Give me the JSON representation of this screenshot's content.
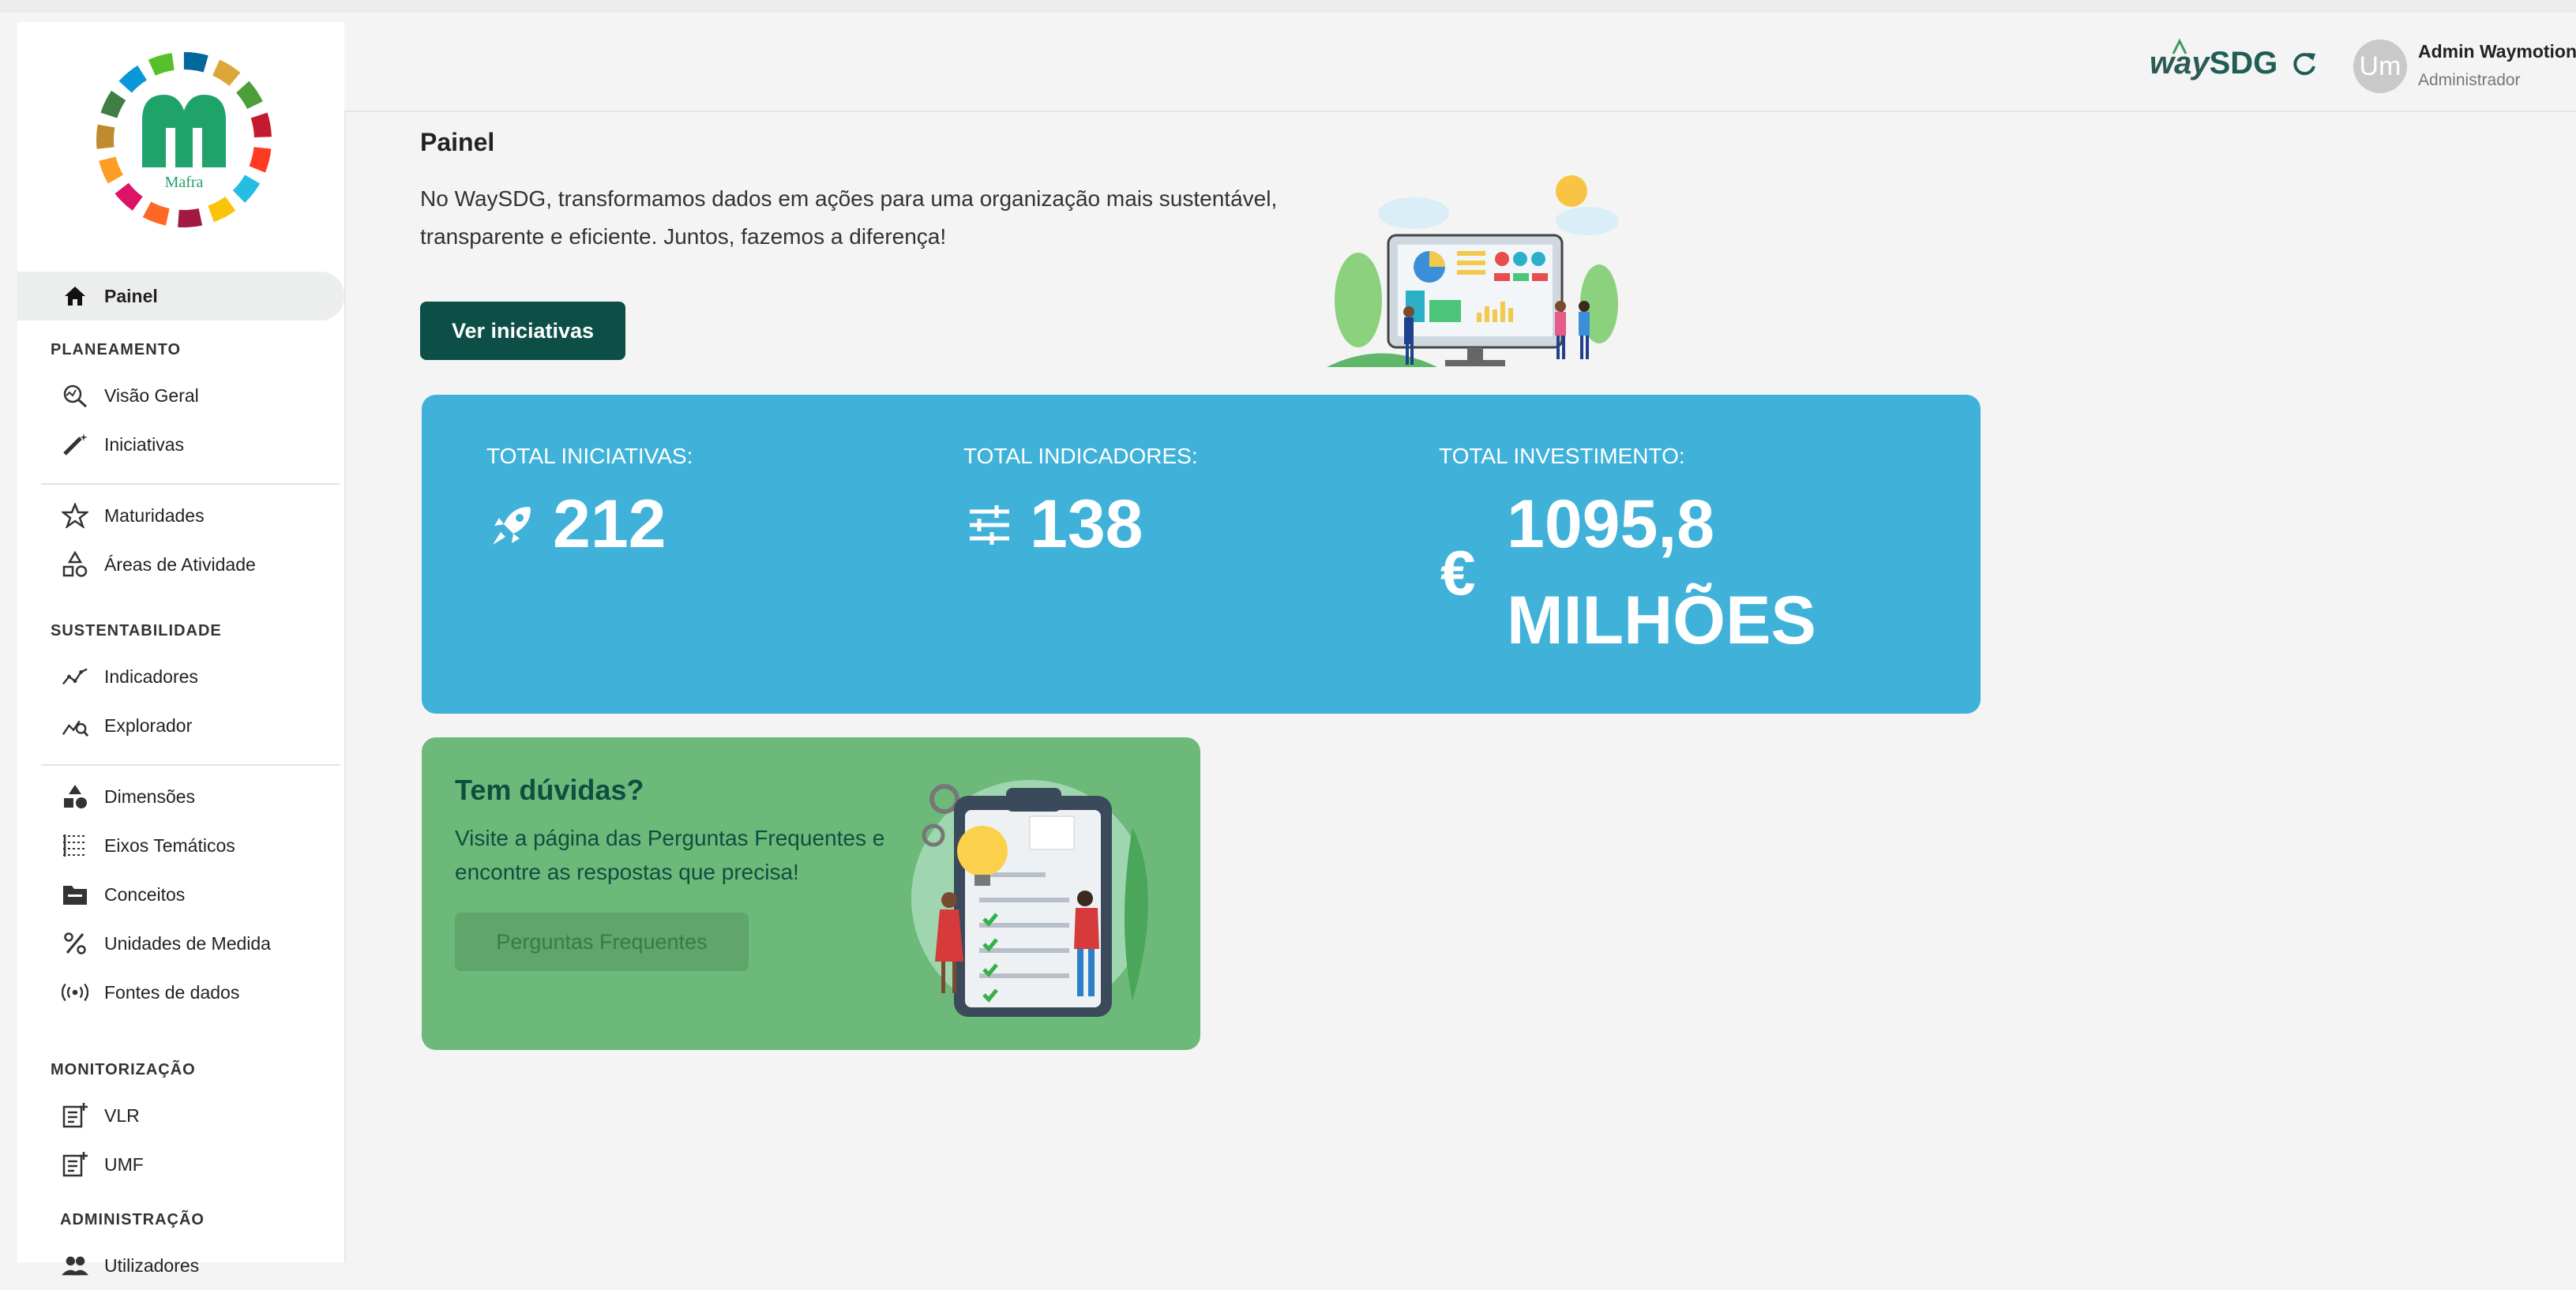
{
  "sidebar": {
    "logo_text": "Mafra",
    "items": [
      {
        "label": "Painel",
        "icon": "home-icon"
      },
      {
        "label": "Visão Geral",
        "icon": "analytics-icon"
      },
      {
        "label": "Iniciativas",
        "icon": "wand-icon"
      },
      {
        "label": "Maturidades",
        "icon": "star-icon"
      },
      {
        "label": "Áreas de Atividade",
        "icon": "shapes-icon"
      },
      {
        "label": "Indicadores",
        "icon": "trend-icon"
      },
      {
        "label": "Explorador",
        "icon": "explore-chart-icon"
      },
      {
        "label": "Dimensões",
        "icon": "category-icon"
      },
      {
        "label": "Eixos Temáticos",
        "icon": "grid-icon"
      },
      {
        "label": "Conceitos",
        "icon": "folder-icon"
      },
      {
        "label": "Unidades de Medida",
        "icon": "percent-icon"
      },
      {
        "label": "Fontes de dados",
        "icon": "broadcast-icon"
      },
      {
        "label": "VLR",
        "icon": "note-add-icon"
      },
      {
        "label": "UMF",
        "icon": "note-add-icon"
      },
      {
        "label": "Utilizadores",
        "icon": "users-icon"
      }
    ],
    "sections": {
      "planeamento": "PLANEAMENTO",
      "sustentabilidade": "SUSTENTABILIDADE",
      "monitorizacao": "MONITORIZAÇÃO",
      "administracao": "ADMINISTRAÇÃO"
    }
  },
  "header": {
    "brand_prefix": "way",
    "brand_suffix": "SDG",
    "user_initials": "Um",
    "user_name": "Admin Waymotion",
    "user_role": "Administrador"
  },
  "main": {
    "title": "Painel",
    "intro": "No WaySDG, transformamos dados em ações para uma organização mais sustentável, transparente e eficiente. Juntos, fazemos a diferença!",
    "cta": "Ver iniciativas",
    "stats": [
      {
        "label": "TOTAL INICIATIVAS:",
        "value": "212",
        "icon": "rocket-icon"
      },
      {
        "label": "TOTAL INDICADORES:",
        "value": "138",
        "icon": "tune-icon"
      },
      {
        "label": "TOTAL INVESTIMENTO:",
        "value": "1095,8",
        "value2": "MILHÕES",
        "icon": "euro-icon"
      }
    ],
    "faq": {
      "title": "Tem dúvidas?",
      "text": "Visite a página das Perguntas Frequentes e encontre as respostas que precisa!",
      "button": "Perguntas Frequentes"
    }
  },
  "colors": {
    "primary": "#0d4f46",
    "stats_bg": "#40b2d9",
    "faq_bg": "#6cb97a"
  }
}
